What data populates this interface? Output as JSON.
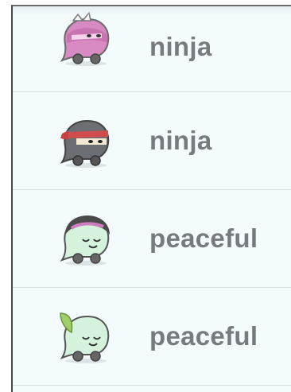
{
  "moods": [
    {
      "label": "ninja",
      "icon": "pink-ninja-waze-icon"
    },
    {
      "label": "ninja",
      "icon": "black-ninja-waze-icon"
    },
    {
      "label": "peaceful",
      "icon": "peaceful-girl-waze-icon"
    },
    {
      "label": "peaceful",
      "icon": "peaceful-leaf-waze-icon"
    }
  ]
}
